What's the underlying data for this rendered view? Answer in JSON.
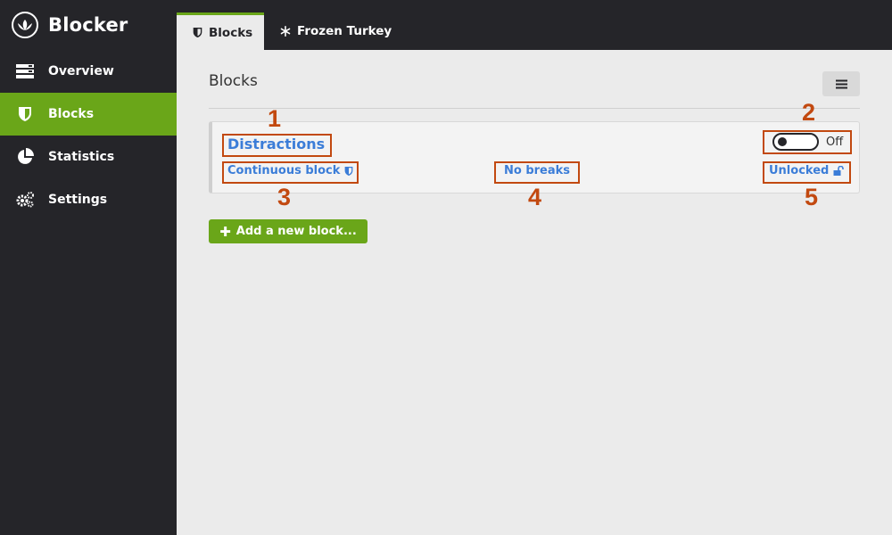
{
  "app": {
    "title": "Blocker"
  },
  "sidebar": {
    "items": [
      {
        "label": "Overview",
        "icon": "server-icon"
      },
      {
        "label": "Blocks",
        "icon": "shield-icon",
        "active": true
      },
      {
        "label": "Statistics",
        "icon": "pie-chart-icon"
      },
      {
        "label": "Settings",
        "icon": "gears-icon"
      }
    ]
  },
  "tabs": [
    {
      "label": "Blocks",
      "icon": "shield-icon",
      "active": true
    },
    {
      "label": "Frozen Turkey",
      "icon": "snowflake-icon"
    }
  ],
  "main": {
    "title": "Blocks",
    "menu_icon": "hamburger-icon",
    "block": {
      "name": "Distractions",
      "toggle_label": "Off",
      "toggle_on": false,
      "type_label": "Continuous block",
      "breaks_label": "No breaks",
      "lock_label": "Unlocked"
    },
    "add_button": {
      "label": "Add a new block..."
    }
  },
  "annotations": [
    "1",
    "2",
    "3",
    "4",
    "5"
  ],
  "colors": {
    "accent": "#6aa619",
    "sidebar": "#252529",
    "link": "#3b7dd8",
    "annotation": "#c24910"
  }
}
